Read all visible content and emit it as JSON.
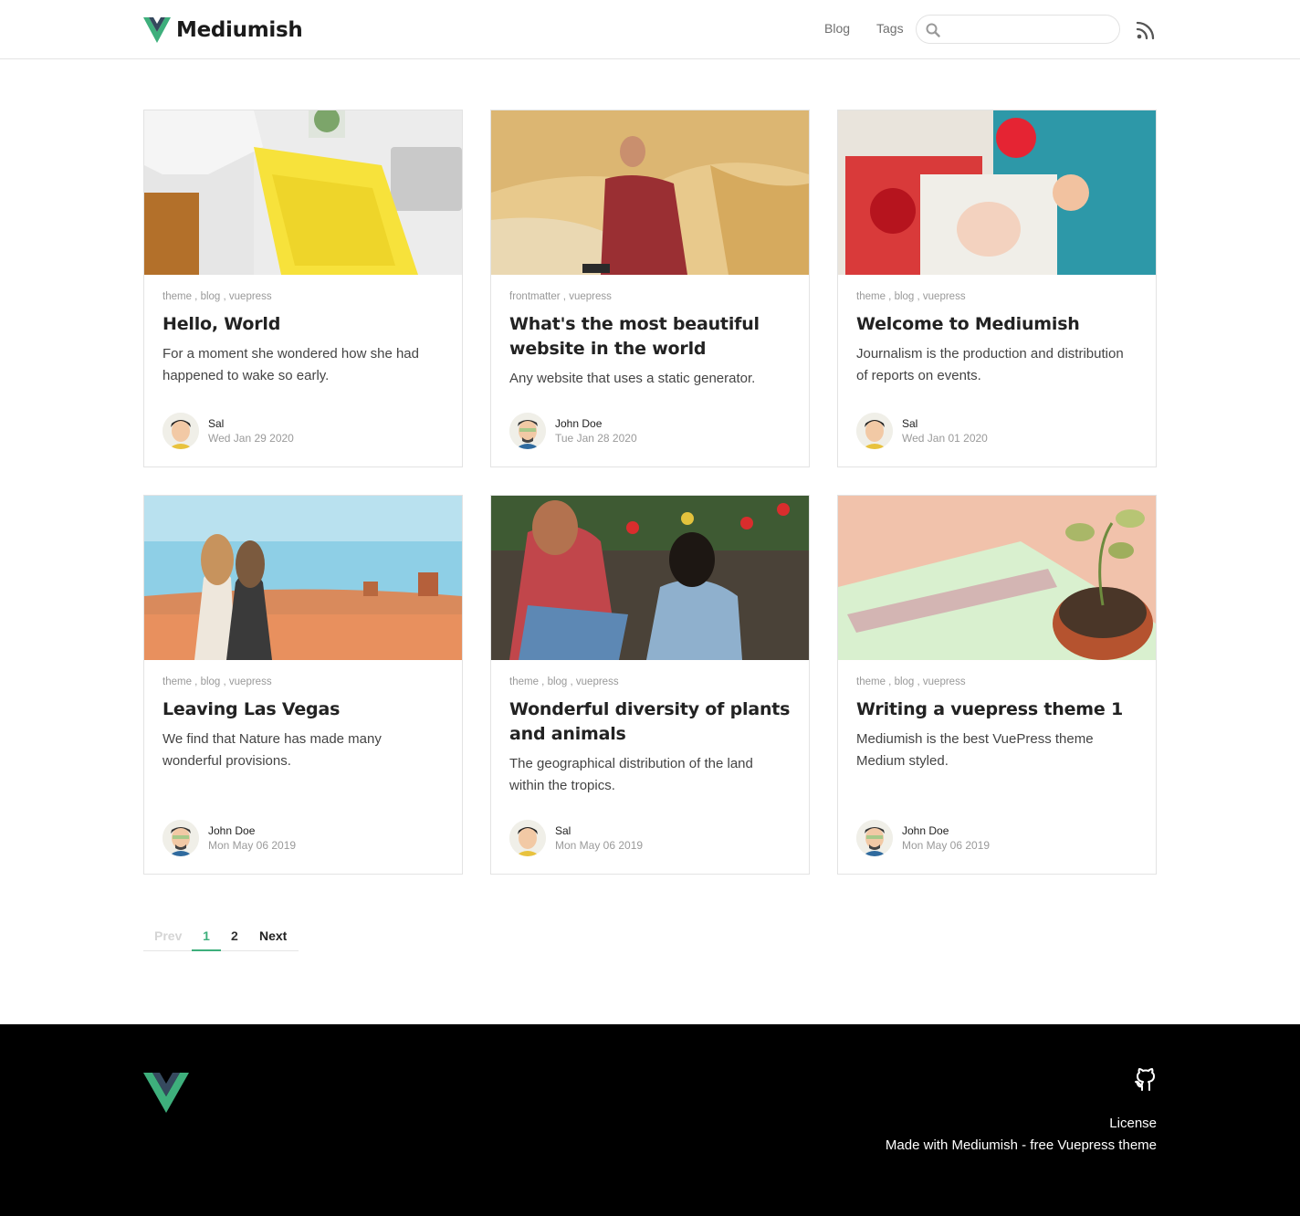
{
  "header": {
    "brand": "Mediumish",
    "nav": {
      "blog": "Blog",
      "tags": "Tags"
    },
    "search": {
      "value": "",
      "placeholder": ""
    },
    "icons": {
      "logo": "vue-logo-icon",
      "search": "search-icon",
      "rss": "rss-icon"
    }
  },
  "posts": [
    {
      "tags": [
        "theme",
        "blog",
        "vuepress"
      ],
      "title": "Hello, World",
      "excerpt": "For a moment she wondered how she had happened to wake so early.",
      "author": "Sal",
      "date": "Wed Jan 29 2020",
      "image": "magazine-reading-photo"
    },
    {
      "tags": [
        "frontmatter",
        "vuepress"
      ],
      "title": "What's the most beautiful website in the world",
      "excerpt": "Any website that uses a static generator.",
      "author": "John Doe",
      "date": "Tue Jan 28 2020",
      "image": "girl-by-rock-photo"
    },
    {
      "tags": [
        "theme",
        "blog",
        "vuepress"
      ],
      "title": "Welcome to Mediumish",
      "excerpt": "Journalism is the production and distribution of reports on events.",
      "author": "Sal",
      "date": "Wed Jan 01 2020",
      "image": "fashion-magazines-photo"
    },
    {
      "tags": [
        "theme",
        "blog",
        "vuepress"
      ],
      "title": "Leaving Las Vegas",
      "excerpt": "We find that Nature has made many wonderful provisions.",
      "author": "John Doe",
      "date": "Mon May 06 2019",
      "image": "desert-friends-photo"
    },
    {
      "tags": [
        "theme",
        "blog",
        "vuepress"
      ],
      "title": "Wonderful diversity of plants and animals",
      "excerpt": "The geographical distribution of the land within the tropics.",
      "author": "Sal",
      "date": "Mon May 06 2019",
      "image": "girls-in-tulips-photo"
    },
    {
      "tags": [
        "theme",
        "blog",
        "vuepress"
      ],
      "title": "Writing a vuepress theme 1",
      "excerpt": "Mediumish is the best VuePress theme Medium styled.",
      "author": "John Doe",
      "date": "Mon May 06 2019",
      "image": "the-sting-record-photo"
    }
  ],
  "pagination": {
    "prev": "Prev",
    "pages": [
      "1",
      "2"
    ],
    "current": "1",
    "next": "Next"
  },
  "footer": {
    "license": "License",
    "made_with": "Made with Mediumish - free Vuepress theme",
    "icons": {
      "logo": "vue-logo-icon",
      "github": "github-icon"
    }
  },
  "colors": {
    "accent": "#3eaf7c",
    "logo_dark": "#35495e",
    "footer_bg": "#000000"
  }
}
